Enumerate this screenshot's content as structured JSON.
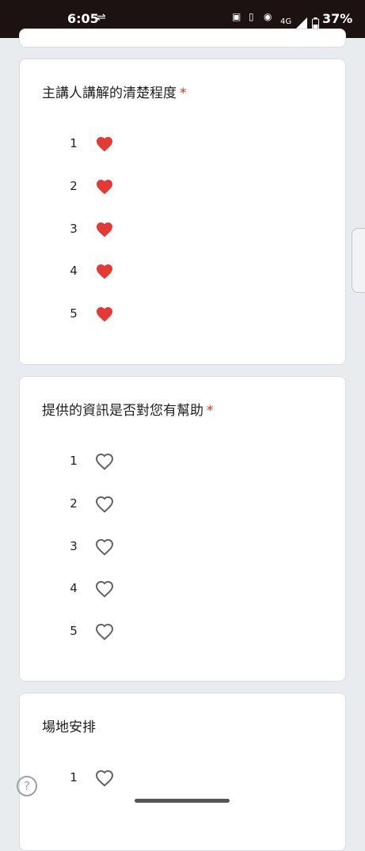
{
  "status_bar": {
    "time": "6:05",
    "network": "4G",
    "battery": "37%"
  },
  "questions": [
    {
      "title": "主講人講解的清楚程度",
      "required_mark": "*",
      "options": [
        "1",
        "2",
        "3",
        "4",
        "5"
      ],
      "selected_rating": 5,
      "heart_icon": "heart-filled"
    },
    {
      "title": "提供的資訊是否對您有幫助",
      "required_mark": "*",
      "options": [
        "1",
        "2",
        "3",
        "4",
        "5"
      ],
      "selected_rating": 0,
      "heart_icon": "heart-outline"
    },
    {
      "title": "場地安排",
      "options": [
        "1"
      ],
      "selected_rating": 0,
      "heart_icon": "heart-outline"
    }
  ],
  "help_icon": "?",
  "colors": {
    "heart_filled": "#e53935",
    "heart_outline": "#5f6368",
    "required": "#d93025"
  }
}
